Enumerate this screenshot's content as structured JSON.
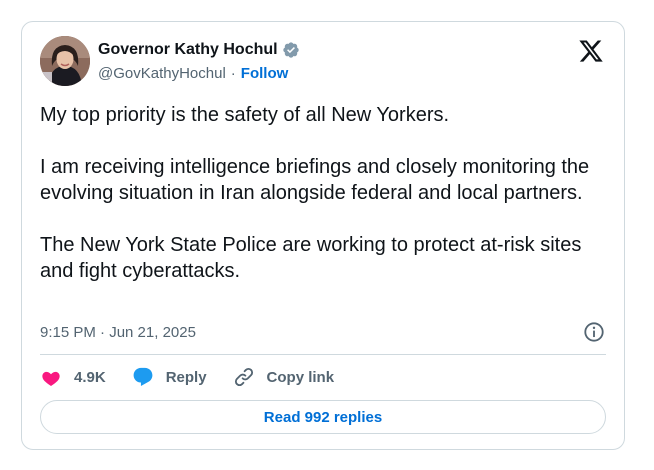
{
  "author": {
    "name": "Governor Kathy Hochul",
    "handle": "@GovKathyHochul",
    "separator": "·",
    "follow_label": "Follow",
    "verified_color": "#829aab"
  },
  "post": {
    "paragraphs": [
      "My top priority is the safety of all New Yorkers.",
      "I am receiving intelligence briefings and closely monitoring the evolving situation in Iran alongside federal and local partners.",
      "The New York State Police are working to protect at-risk sites and fight cyberattacks."
    ],
    "timestamp": "9:15 PM · Jun 21, 2025"
  },
  "actions": {
    "likes_count": "4.9K",
    "reply_label": "Reply",
    "copy_link_label": "Copy link"
  },
  "footer": {
    "read_replies_label": "Read 992 replies"
  },
  "colors": {
    "like": "#f91880",
    "reply": "#1d9bf0",
    "link": "#006fd6",
    "muted": "#536471",
    "border": "#cfd9de"
  },
  "icons": [
    "verified-badge-icon",
    "x-logo-icon",
    "info-icon",
    "heart-icon",
    "reply-bubble-icon",
    "link-icon"
  ]
}
